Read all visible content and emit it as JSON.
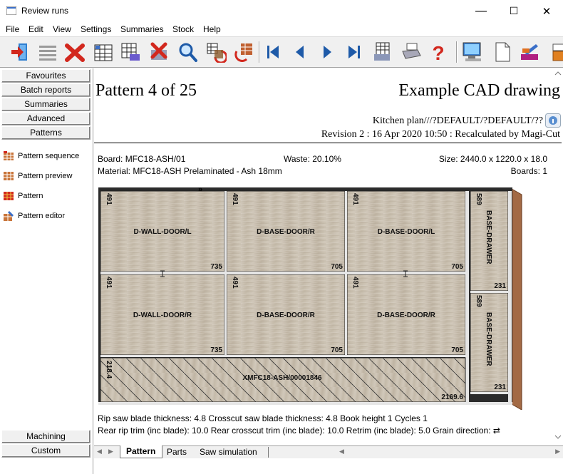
{
  "window": {
    "title": "Review runs",
    "minimize": "—",
    "maximize": "☐",
    "close": "✕"
  },
  "menu": [
    "File",
    "Edit",
    "View",
    "Settings",
    "Summaries",
    "Stock",
    "Help"
  ],
  "toolbar": {
    "buttons": [
      "exit-icon",
      "list-icon",
      "delete-icon",
      "grid-icon",
      "grid-print-icon",
      "delete-print-icon",
      "search-icon",
      "rotate-icon",
      "rotate-red-icon",
      "first-icon",
      "previous-icon",
      "next-icon",
      "last-icon",
      "report-icon",
      "printer-icon",
      "help-icon",
      "monitor-icon",
      "page-icon",
      "palette-icon",
      "box-icon"
    ]
  },
  "sidebar": {
    "top_buttons": [
      "Favourites",
      "Batch reports",
      "Summaries",
      "Advanced",
      "Patterns"
    ],
    "items": [
      "Pattern sequence",
      "Pattern preview",
      "Pattern",
      "Pattern editor"
    ],
    "bottom_buttons": [
      "Machining",
      "Custom"
    ]
  },
  "header": {
    "title": "Pattern 4 of 25",
    "right_title": "Example CAD drawing",
    "line1": "Kitchen plan///?DEFAULT/?DEFAULT/??",
    "line2": "Revision 2 : 16 Apr 2020 10:50 : Recalculated by Magi-Cut"
  },
  "board": {
    "board": "Board: MFC18-ASH/01",
    "waste": "Waste: 20.10%",
    "size": "Size: 2440.0 x 1220.0 x  18.0",
    "material": "Material: MFC18-ASH  Prelaminated - Ash 18mm",
    "boards": "Boards: 1"
  },
  "pattern": {
    "panels": [
      {
        "label": "D-WALL-DOOR/L",
        "w": "735",
        "h": "491"
      },
      {
        "label": "D-BASE-DOOR/R",
        "w": "705",
        "h": "491"
      },
      {
        "label": "D-BASE-DOOR/L",
        "w": "705",
        "h": "491"
      },
      {
        "label": "D-WALL-DOOR/R",
        "w": "735",
        "h": "491"
      },
      {
        "label": "D-BASE-DOOR/R",
        "w": "705",
        "h": "491"
      },
      {
        "label": "D-BASE-DOOR/R",
        "w": "705",
        "h": "491"
      }
    ],
    "drawers": [
      {
        "label": "BASE-DRAWER",
        "w": "231",
        "h": "589"
      },
      {
        "label": "BASE-DRAWER",
        "w": "231",
        "h": "589"
      }
    ],
    "offcut": {
      "label": "XMFC18-ASH/00001846",
      "w": "2169.6",
      "h": "218.4"
    }
  },
  "footer": {
    "line1": "Rip saw blade thickness: 4.8  Crosscut saw blade thickness: 4.8  Book height 1  Cycles 1",
    "line2": "Rear rip trim (inc blade): 10.0 Rear crosscut trim (inc blade): 10.0 Retrim (inc blade): 5.0 Grain direction: ⇄"
  },
  "tabs": [
    "Pattern",
    "Parts",
    "Saw simulation"
  ],
  "colors": {
    "panel": "#cdc4b6",
    "panel_dark": "#b8ad9d",
    "edge": "#9a6c4a",
    "cut": "#e8e8e8"
  }
}
